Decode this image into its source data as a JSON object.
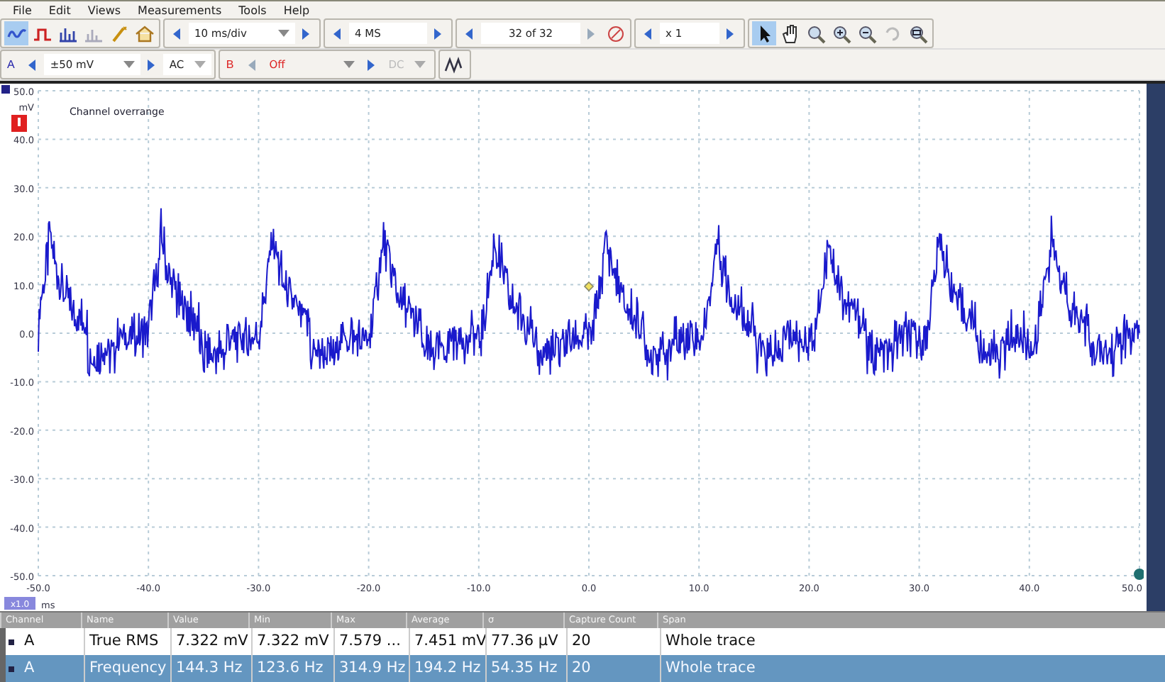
{
  "menu": [
    "File",
    "Edit",
    "Views",
    "Measurements",
    "Tools",
    "Help"
  ],
  "toolbar": {
    "timebase": "10 ms/div",
    "samples": "4 MS",
    "buffer": "32 of 32",
    "zoom": "x 1",
    "tools": [
      {
        "kind": "pointer",
        "selected": true
      },
      {
        "kind": "hand",
        "selected": false
      },
      {
        "kind": "zoom",
        "selected": false
      },
      {
        "kind": "zoom-in",
        "selected": false
      },
      {
        "kind": "zoom-out",
        "selected": false
      },
      {
        "kind": "undo",
        "selected": false
      },
      {
        "kind": "zoom-fit",
        "selected": false
      }
    ]
  },
  "channels": [
    {
      "name": "A",
      "range": "±50 mV",
      "coupling": "AC",
      "color": "#2222aa",
      "disabled": false
    },
    {
      "name": "B",
      "range": "Off",
      "coupling": "DC",
      "color": "#dd2222",
      "disabled": true
    }
  ],
  "plot": {
    "note": "Channel overrange",
    "y_unit": "mV",
    "x_unit": "ms",
    "x_zoom": "x1.0",
    "yticks": [
      "50.0",
      "40.0",
      "30.0",
      "20.0",
      "10.0",
      "0.0",
      "-10.0",
      "-20.0",
      "-30.0",
      "-40.0",
      "-50.0"
    ],
    "xticks": [
      "-50.0",
      "-40.0",
      "-30.0",
      "-20.0",
      "-10.0",
      "0.0",
      "10.0",
      "20.0",
      "30.0",
      "40.0",
      "50.0"
    ]
  },
  "table": {
    "columns": [
      "Channel",
      "Name",
      "Value",
      "Min",
      "Max",
      "Average",
      "σ",
      "Capture Count",
      "Span"
    ],
    "rows": [
      {
        "selected": false,
        "cells": [
          "A",
          "True RMS",
          "7.322 mV",
          "7.322 mV",
          "7.579 ...",
          "7.451 mV",
          "77.36 µV",
          "20",
          "Whole trace"
        ]
      },
      {
        "selected": true,
        "cells": [
          "A",
          "Frequency",
          "144.3 Hz",
          "123.6 Hz",
          "314.9 Hz",
          "194.2 Hz",
          "54.35 Hz",
          "20",
          "Whole trace"
        ]
      }
    ]
  }
}
